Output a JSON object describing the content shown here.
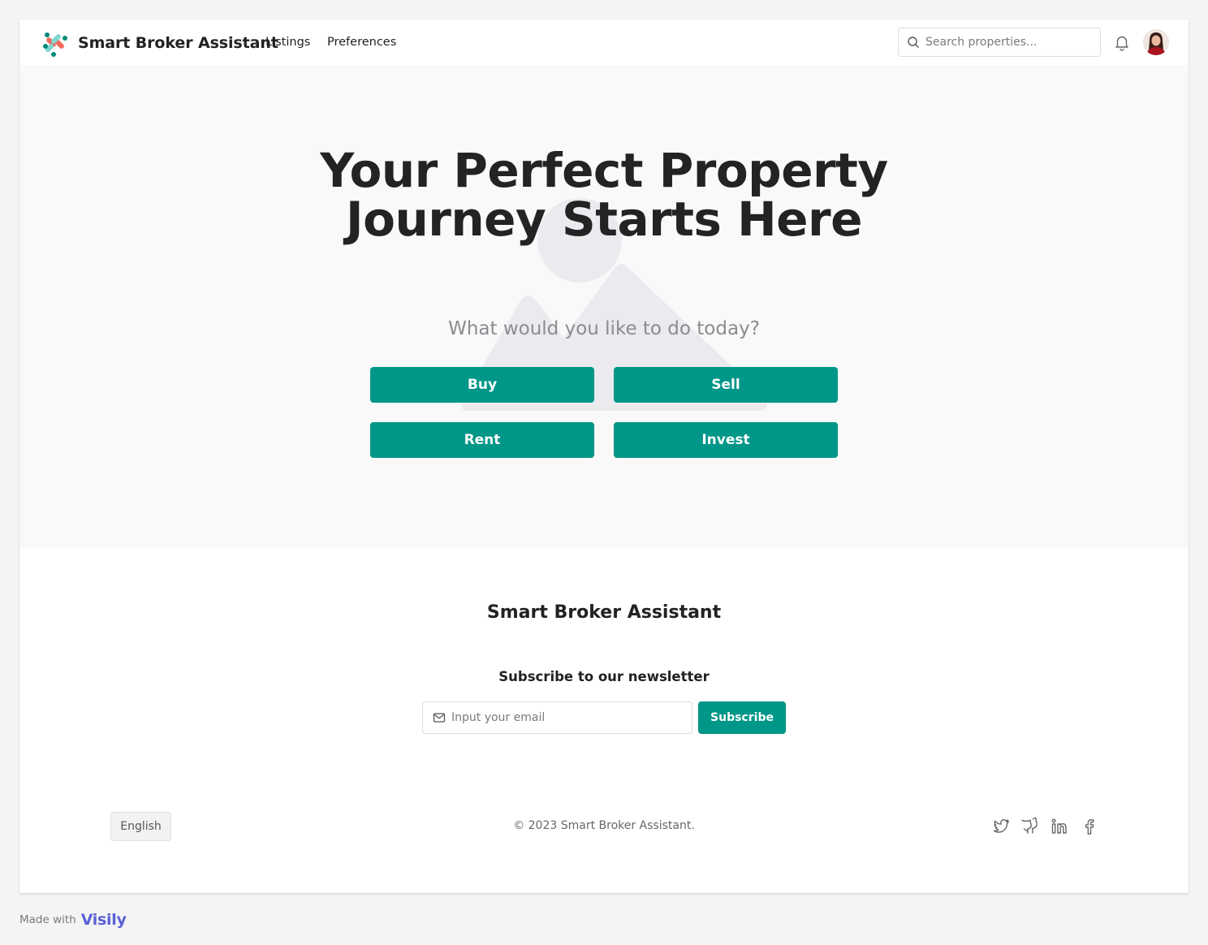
{
  "app": {
    "brand": "Smart Broker Assistant"
  },
  "nav": {
    "items": [
      {
        "label": "Listings"
      },
      {
        "label": "Preferences"
      }
    ]
  },
  "search": {
    "placeholder": "Search properties...",
    "value": ""
  },
  "icons": {
    "search": "search-icon",
    "notifications": "bell-icon",
    "avatar": "user-avatar",
    "email": "mail-icon",
    "social": [
      "twitter-icon",
      "github-icon",
      "linkedin-icon",
      "facebook-icon"
    ]
  },
  "hero": {
    "title": "Your Perfect Property Journey Starts Here",
    "subtitle": "What would you like to do today?",
    "actions": [
      {
        "label": "Buy"
      },
      {
        "label": "Sell"
      },
      {
        "label": "Rent"
      },
      {
        "label": "Invest"
      }
    ]
  },
  "footer": {
    "brand": "Smart Broker Assistant",
    "newsletter_title": "Subscribe to our newsletter",
    "email_placeholder": "Input your email",
    "email_value": "",
    "subscribe_label": "Subscribe",
    "language": "English",
    "copyright": "© 2023 Smart Broker Assistant."
  },
  "made_with": {
    "label": "Made with",
    "brand": "Visily"
  },
  "colors": {
    "primary": "#009688",
    "hero_bg": "#f9f9fa",
    "text_dark": "#232323",
    "text_muted": "#8b8b90",
    "visily": "#5b61d6"
  }
}
